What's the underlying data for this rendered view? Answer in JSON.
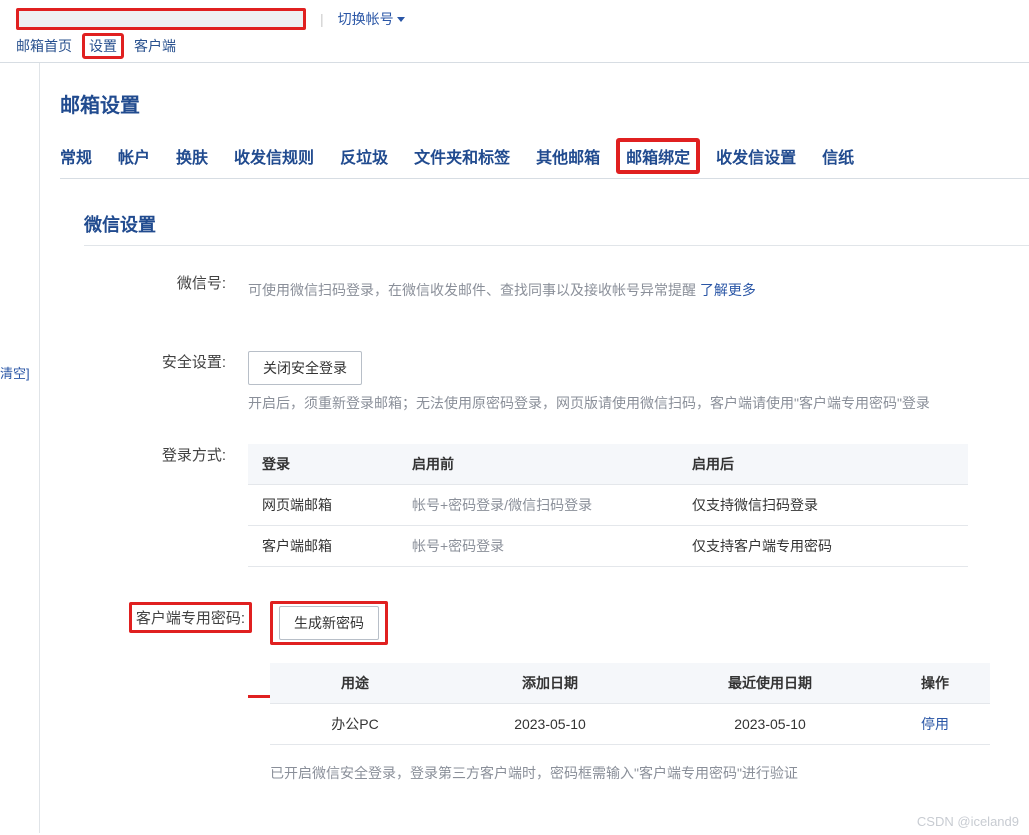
{
  "header": {
    "switch_account": "切换帐号",
    "top_nav": {
      "inbox": "邮箱首页",
      "settings": "设置",
      "client": "客户端"
    }
  },
  "left_rail": {
    "clear": "清空]"
  },
  "page": {
    "title": "邮箱设置",
    "tabs": {
      "general": "常规",
      "account": "帐户",
      "skin": "换肤",
      "rules": "收发信规则",
      "spam": "反垃圾",
      "folders": "文件夹和标签",
      "other_mail": "其他邮箱",
      "binding": "邮箱绑定",
      "send_recv": "收发信设置",
      "stationery": "信纸"
    }
  },
  "wechat": {
    "section_title": "微信设置",
    "wechat_id_label": "微信号:",
    "wechat_hint_prefix": "可使用微信扫码登录，在微信收发邮件、查找同事以及接收帐号异常提醒 ",
    "learn_more": "了解更多",
    "security_label": "安全设置:",
    "close_secure_login_btn": "关闭安全登录",
    "security_hint": "开启后，须重新登录邮箱；无法使用原密码登录，网页版请使用微信扫码，客户端请使用\"客户端专用密码\"登录",
    "login_label": "登录方式:",
    "login_table": {
      "headers": {
        "login": "登录",
        "before": "启用前",
        "after": "启用后"
      },
      "rows": [
        {
          "login": "网页端邮箱",
          "before": "帐号+密码登录/微信扫码登录",
          "after": "仅支持微信扫码登录"
        },
        {
          "login": "客户端邮箱",
          "before": "帐号+密码登录",
          "after": "仅支持客户端专用密码"
        }
      ]
    },
    "client_pwd_label": "客户端专用密码:",
    "gen_pwd_btn": "生成新密码",
    "pwd_table": {
      "headers": {
        "usage": "用途",
        "add_date": "添加日期",
        "last_use": "最近使用日期",
        "action": "操作"
      },
      "rows": [
        {
          "usage": "办公PC",
          "add_date": "2023-05-10",
          "last_use": "2023-05-10",
          "action": "停用"
        }
      ]
    },
    "pwd_hint": "已开启微信安全登录，登录第三方客户端时，密码框需输入\"客户端专用密码\"进行验证"
  },
  "watermark": "CSDN @iceland9"
}
